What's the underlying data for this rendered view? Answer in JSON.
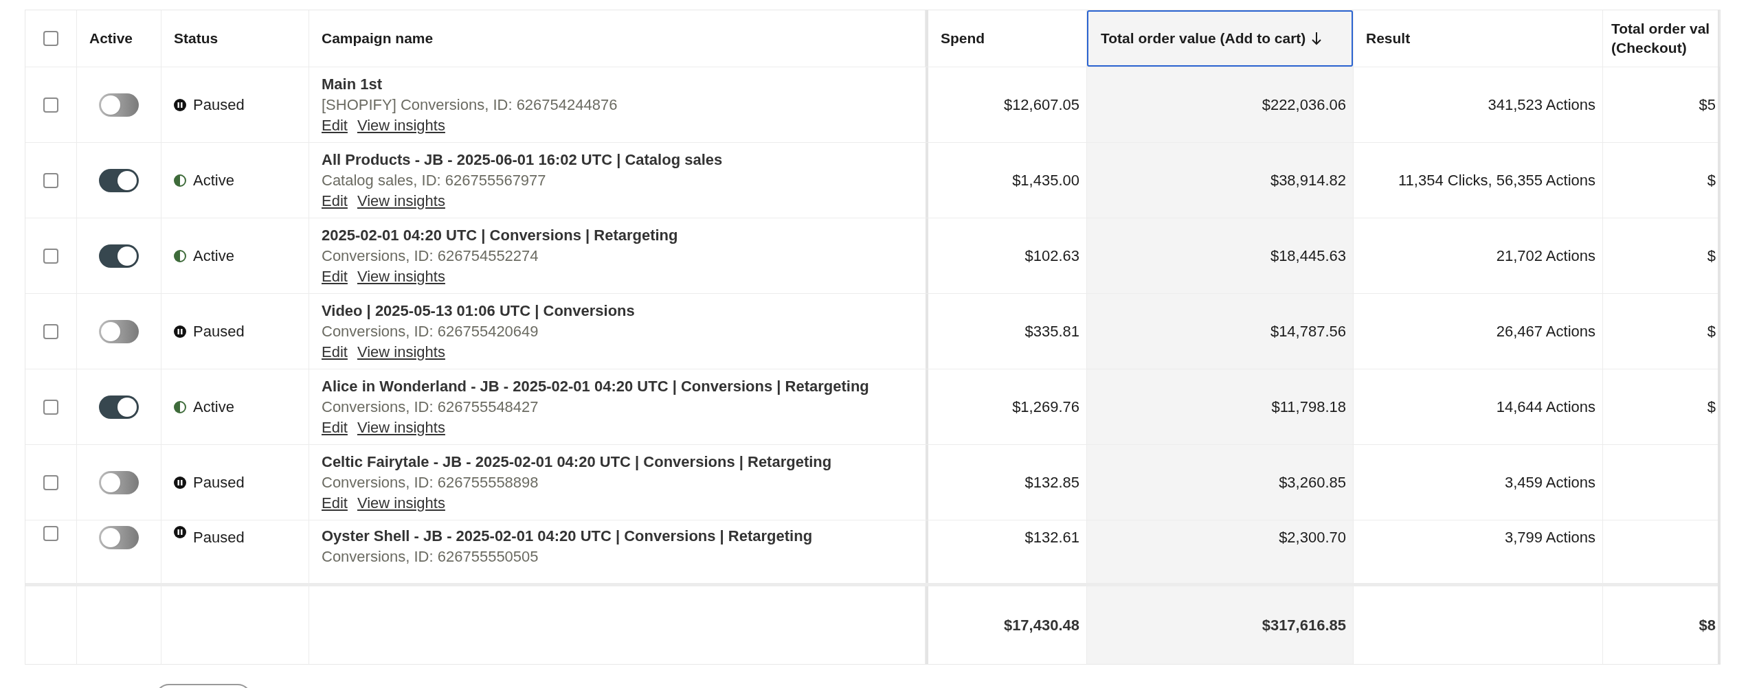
{
  "table": {
    "select_all": {
      "checked": false
    },
    "columns": [
      {
        "label": "Active",
        "sorted": false
      },
      {
        "label": "Status",
        "sorted": false
      },
      {
        "label": "Campaign name",
        "sorted": false
      },
      {
        "label": "Spend",
        "sorted": false
      },
      {
        "label": "Total order value (Add to cart)",
        "sorted": true
      },
      {
        "label": "Result",
        "sorted": false
      },
      {
        "label_lines": [
          "Total order val",
          "(Checkout)"
        ],
        "sorted": false
      }
    ],
    "rows": [
      {
        "checked": false,
        "on": false,
        "status": {
          "kind": "paused",
          "label": "Paused"
        },
        "name": "Main 1st",
        "subtitle": "[SHOPIFY] Conversions, ID: 626754244876",
        "links": [
          "Edit",
          "View insights"
        ],
        "spend": "$12,607.05",
        "order_value": "$222,036.06",
        "result": "341,523 Actions",
        "checkout": "$5"
      },
      {
        "checked": false,
        "on": true,
        "status": {
          "kind": "active",
          "label": "Active"
        },
        "name": "All Products - JB - 2025-06-01 16:02 UTC | Catalog sales",
        "subtitle": "Catalog sales, ID: 626755567977",
        "links": [
          "Edit",
          "View insights"
        ],
        "spend": "$1,435.00",
        "order_value": "$38,914.82",
        "result": "11,354 Clicks, 56,355 Actions",
        "checkout": "$"
      },
      {
        "checked": false,
        "on": true,
        "status": {
          "kind": "active",
          "label": "Active"
        },
        "name": "2025-02-01 04:20 UTC | Conversions | Retargeting",
        "subtitle": "Conversions, ID: 626754552274",
        "links": [
          "Edit",
          "View insights"
        ],
        "spend": "$102.63",
        "order_value": "$18,445.63",
        "result": "21,702 Actions",
        "checkout": "$"
      },
      {
        "checked": false,
        "on": false,
        "status": {
          "kind": "paused",
          "label": "Paused"
        },
        "name": "Video | 2025-05-13 01:06 UTC | Conversions",
        "subtitle": "Conversions, ID: 626755420649",
        "links": [
          "Edit",
          "View insights"
        ],
        "spend": "$335.81",
        "order_value": "$14,787.56",
        "result": "26,467 Actions",
        "checkout": "$"
      },
      {
        "checked": false,
        "on": true,
        "status": {
          "kind": "active",
          "label": "Active"
        },
        "name": "Alice in Wonderland - JB - 2025-02-01 04:20 UTC | Conversions | Retargeting",
        "subtitle": "Conversions, ID: 626755548427",
        "links": [
          "Edit",
          "View insights"
        ],
        "spend": "$1,269.76",
        "order_value": "$11,798.18",
        "result": "14,644 Actions",
        "checkout": "$"
      },
      {
        "checked": false,
        "on": false,
        "status": {
          "kind": "paused",
          "label": "Paused"
        },
        "name": "Celtic Fairytale - JB - 2025-02-01 04:20 UTC | Conversions | Retargeting",
        "subtitle": "Conversions, ID: 626755558898",
        "links": [
          "Edit",
          "View insights"
        ],
        "spend": "$132.85",
        "order_value": "$3,260.85",
        "result": "3,459 Actions"
      },
      {
        "checked": false,
        "on": false,
        "status": {
          "kind": "paused",
          "label": "Paused"
        },
        "name": "Oyster Shell - JB - 2025-02-01 04:20 UTC | Conversions | Retargeting",
        "subtitle": "Conversions, ID: 626755550505",
        "spend": "$132.61",
        "order_value": "$2,300.70",
        "result": "3,799 Actions"
      }
    ],
    "totals": {
      "spend": "$17,430.48",
      "order_value": "$317,616.85",
      "checkout": "$8"
    }
  }
}
